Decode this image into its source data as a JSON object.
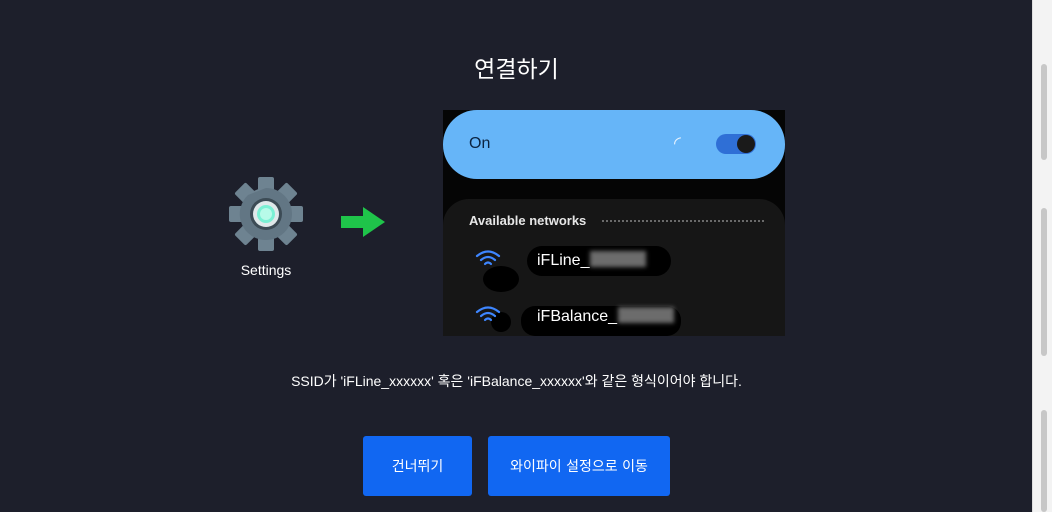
{
  "title": "연결하기",
  "settings": {
    "label": "Settings",
    "icon": "gear-icon"
  },
  "arrow_icon": "arrow-right-icon",
  "phone": {
    "toggle_label": "On",
    "toggle_on": true,
    "available_label": "Available networks",
    "networks": [
      {
        "name": "iFLine_",
        "icon": "wifi-icon"
      },
      {
        "name": "iFBalance_",
        "icon": "wifi-icon"
      }
    ]
  },
  "description": "SSID가 'iFLine_xxxxxx' 혹은 'iFBalance_xxxxxx'와 같은 형식이어야 합니다.",
  "buttons": {
    "skip": "건너뛰기",
    "wifi_settings": "와이파이 설정으로 이동"
  },
  "colors": {
    "background": "#1d1f2b",
    "accent": "#1167f2",
    "toggle_bar": "#66b5f8",
    "arrow": "#1fc44a"
  }
}
